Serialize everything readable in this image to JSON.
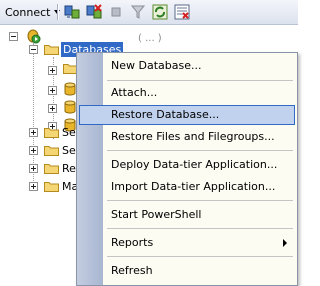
{
  "toolbar": {
    "connect_label": "Connect",
    "icons": [
      "connect-object-explorer-icon",
      "disconnect-icon",
      "stop-icon",
      "filter-icon",
      "refresh-icon",
      "object-explorer-details-icon"
    ]
  },
  "tree": {
    "selected_node": "Databases",
    "partial_nodes": [
      "Se",
      "Se",
      "Re",
      "Ma"
    ],
    "faded_text": "( ... )"
  },
  "context_menu": {
    "items": [
      {
        "label": "New Database..."
      },
      {
        "label": "Attach..."
      },
      {
        "label": "Restore Database..."
      },
      {
        "label": "Restore Files and Filegroups..."
      },
      {
        "label": "Deploy Data-tier Application..."
      },
      {
        "label": "Import Data-tier Application..."
      },
      {
        "label": "Start PowerShell"
      },
      {
        "label": "Reports"
      },
      {
        "label": "Refresh"
      }
    ],
    "highlighted_item": "Restore Database..."
  },
  "colors": {
    "selection": "#3169c6",
    "menu_highlight": "#c1d2ee",
    "menu_highlight_border": "#316ac5",
    "menu_background": "#fcfcf3",
    "menu_gutter": "#b3bfd9"
  }
}
